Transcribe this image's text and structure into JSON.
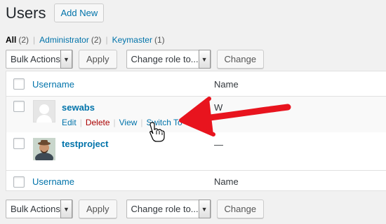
{
  "page": {
    "title": "Users",
    "add_new_label": "Add New"
  },
  "filters": [
    {
      "label": "All",
      "count": "(2)"
    },
    {
      "label": "Administrator",
      "count": "(2)"
    },
    {
      "label": "Keymaster",
      "count": "(1)"
    }
  ],
  "top_actions": {
    "bulk_label": "Bulk Actions",
    "apply_label": "Apply",
    "role_label": "Change role to...",
    "change_label": "Change"
  },
  "bottom_actions": {
    "bulk_label": "Bulk Actions",
    "apply_label": "Apply",
    "role_label": "Change role to...",
    "change_label": "Change"
  },
  "table": {
    "columns": {
      "username": "Username",
      "name": "Name"
    },
    "users": [
      {
        "username": "sewabs",
        "name_value": "W",
        "actions": [
          "Edit",
          "Delete",
          "View",
          "Switch To"
        ]
      },
      {
        "username": "testproject",
        "name_value": "—"
      }
    ]
  },
  "colors": {
    "link": "#0073aa",
    "delete": "#aa0000",
    "annotation_arrow": "#e8141e"
  },
  "icons": {
    "dropdown": "chevron-down-icon",
    "cursor": "hand-pointer-icon",
    "annotation": "red-arrow-icon"
  }
}
